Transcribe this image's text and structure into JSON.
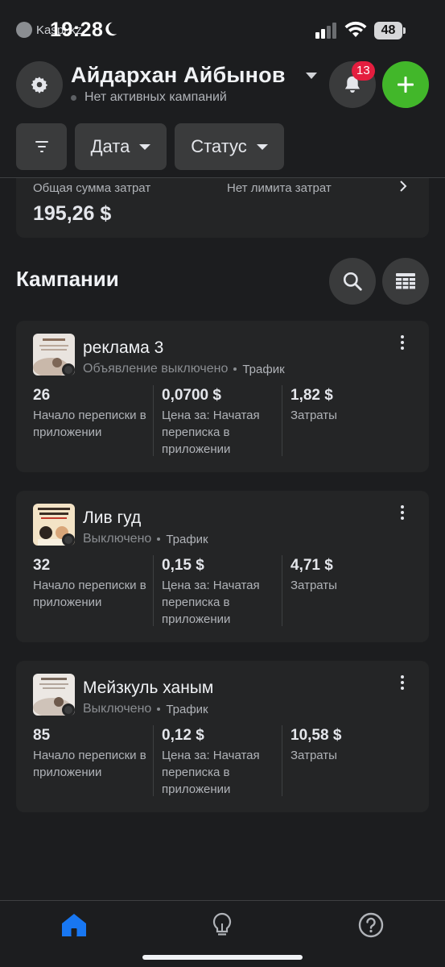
{
  "status_bar": {
    "time": "19:28",
    "carrier_app": "Kaspi.kz",
    "battery": "48"
  },
  "header": {
    "user_name": "Айдархан Айбынов",
    "subtitle": "Нет активных кампаний",
    "notifications_count": "13"
  },
  "filters": {
    "date_label": "Дата",
    "status_label": "Статус"
  },
  "spend": {
    "total_label": "Общая сумма затрат",
    "total_value": "195,26 $",
    "limit_label": "Нет лимита затрат"
  },
  "campaigns": {
    "title": "Кампании",
    "items": [
      {
        "name": "реклама 3",
        "status": "Объявление выключено",
        "objective": "Трафик",
        "results_value": "26",
        "results_label": "Начало переписки в приложении",
        "cost_value": "0,0700 $",
        "cost_label": "Цена за: Начатая переписка в приложении",
        "spend_value": "1,82 $",
        "spend_label": "Затраты"
      },
      {
        "name": "Лив гуд",
        "status": "Выключено",
        "objective": "Трафик",
        "results_value": "32",
        "results_label": "Начало переписки в приложении",
        "cost_value": "0,15 $",
        "cost_label": "Цена за: Начатая переписка в приложении",
        "spend_value": "4,71 $",
        "spend_label": "Затраты"
      },
      {
        "name": "Мейзкуль ханым",
        "status": "Выключено",
        "objective": "Трафик",
        "results_value": "85",
        "results_label": "Начало переписки в приложении",
        "cost_value": "0,12 $",
        "cost_label": "Цена за: Начатая переписка в приложении",
        "spend_value": "10,58 $",
        "spend_label": "Затраты"
      }
    ]
  },
  "bottom_nav": {
    "items": [
      "home-icon",
      "lightbulb-icon",
      "help-icon"
    ],
    "active": "home-icon"
  },
  "colors": {
    "background": "#1c1d1f",
    "card": "#242526",
    "button": "#3a3b3c",
    "accent_green": "#42b72a",
    "badge_red": "#e41e3f",
    "nav_active_blue": "#1877f2"
  }
}
